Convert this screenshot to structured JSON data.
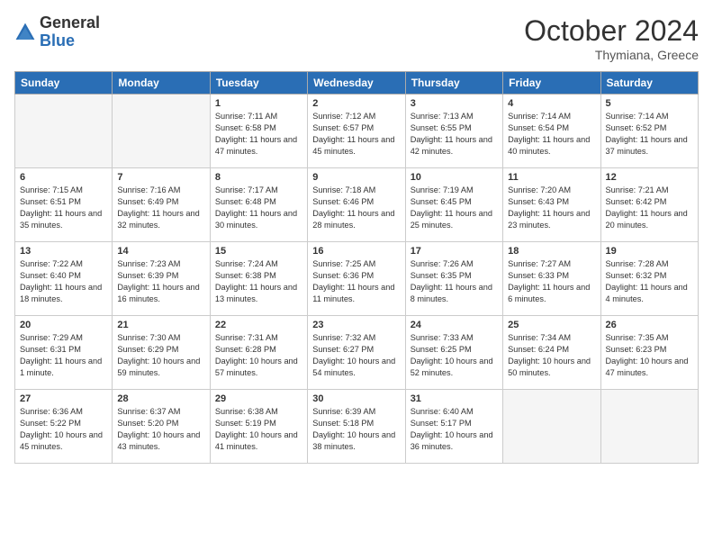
{
  "header": {
    "logo_general": "General",
    "logo_blue": "Blue",
    "month_title": "October 2024",
    "subtitle": "Thymiana, Greece"
  },
  "weekdays": [
    "Sunday",
    "Monday",
    "Tuesday",
    "Wednesday",
    "Thursday",
    "Friday",
    "Saturday"
  ],
  "weeks": [
    [
      {
        "day": "",
        "sunrise": "",
        "sunset": "",
        "daylight": "",
        "empty": true
      },
      {
        "day": "",
        "sunrise": "",
        "sunset": "",
        "daylight": "",
        "empty": true
      },
      {
        "day": "1",
        "sunrise": "Sunrise: 7:11 AM",
        "sunset": "Sunset: 6:58 PM",
        "daylight": "Daylight: 11 hours and 47 minutes.",
        "empty": false
      },
      {
        "day": "2",
        "sunrise": "Sunrise: 7:12 AM",
        "sunset": "Sunset: 6:57 PM",
        "daylight": "Daylight: 11 hours and 45 minutes.",
        "empty": false
      },
      {
        "day": "3",
        "sunrise": "Sunrise: 7:13 AM",
        "sunset": "Sunset: 6:55 PM",
        "daylight": "Daylight: 11 hours and 42 minutes.",
        "empty": false
      },
      {
        "day": "4",
        "sunrise": "Sunrise: 7:14 AM",
        "sunset": "Sunset: 6:54 PM",
        "daylight": "Daylight: 11 hours and 40 minutes.",
        "empty": false
      },
      {
        "day": "5",
        "sunrise": "Sunrise: 7:14 AM",
        "sunset": "Sunset: 6:52 PM",
        "daylight": "Daylight: 11 hours and 37 minutes.",
        "empty": false
      }
    ],
    [
      {
        "day": "6",
        "sunrise": "Sunrise: 7:15 AM",
        "sunset": "Sunset: 6:51 PM",
        "daylight": "Daylight: 11 hours and 35 minutes.",
        "empty": false
      },
      {
        "day": "7",
        "sunrise": "Sunrise: 7:16 AM",
        "sunset": "Sunset: 6:49 PM",
        "daylight": "Daylight: 11 hours and 32 minutes.",
        "empty": false
      },
      {
        "day": "8",
        "sunrise": "Sunrise: 7:17 AM",
        "sunset": "Sunset: 6:48 PM",
        "daylight": "Daylight: 11 hours and 30 minutes.",
        "empty": false
      },
      {
        "day": "9",
        "sunrise": "Sunrise: 7:18 AM",
        "sunset": "Sunset: 6:46 PM",
        "daylight": "Daylight: 11 hours and 28 minutes.",
        "empty": false
      },
      {
        "day": "10",
        "sunrise": "Sunrise: 7:19 AM",
        "sunset": "Sunset: 6:45 PM",
        "daylight": "Daylight: 11 hours and 25 minutes.",
        "empty": false
      },
      {
        "day": "11",
        "sunrise": "Sunrise: 7:20 AM",
        "sunset": "Sunset: 6:43 PM",
        "daylight": "Daylight: 11 hours and 23 minutes.",
        "empty": false
      },
      {
        "day": "12",
        "sunrise": "Sunrise: 7:21 AM",
        "sunset": "Sunset: 6:42 PM",
        "daylight": "Daylight: 11 hours and 20 minutes.",
        "empty": false
      }
    ],
    [
      {
        "day": "13",
        "sunrise": "Sunrise: 7:22 AM",
        "sunset": "Sunset: 6:40 PM",
        "daylight": "Daylight: 11 hours and 18 minutes.",
        "empty": false
      },
      {
        "day": "14",
        "sunrise": "Sunrise: 7:23 AM",
        "sunset": "Sunset: 6:39 PM",
        "daylight": "Daylight: 11 hours and 16 minutes.",
        "empty": false
      },
      {
        "day": "15",
        "sunrise": "Sunrise: 7:24 AM",
        "sunset": "Sunset: 6:38 PM",
        "daylight": "Daylight: 11 hours and 13 minutes.",
        "empty": false
      },
      {
        "day": "16",
        "sunrise": "Sunrise: 7:25 AM",
        "sunset": "Sunset: 6:36 PM",
        "daylight": "Daylight: 11 hours and 11 minutes.",
        "empty": false
      },
      {
        "day": "17",
        "sunrise": "Sunrise: 7:26 AM",
        "sunset": "Sunset: 6:35 PM",
        "daylight": "Daylight: 11 hours and 8 minutes.",
        "empty": false
      },
      {
        "day": "18",
        "sunrise": "Sunrise: 7:27 AM",
        "sunset": "Sunset: 6:33 PM",
        "daylight": "Daylight: 11 hours and 6 minutes.",
        "empty": false
      },
      {
        "day": "19",
        "sunrise": "Sunrise: 7:28 AM",
        "sunset": "Sunset: 6:32 PM",
        "daylight": "Daylight: 11 hours and 4 minutes.",
        "empty": false
      }
    ],
    [
      {
        "day": "20",
        "sunrise": "Sunrise: 7:29 AM",
        "sunset": "Sunset: 6:31 PM",
        "daylight": "Daylight: 11 hours and 1 minute.",
        "empty": false
      },
      {
        "day": "21",
        "sunrise": "Sunrise: 7:30 AM",
        "sunset": "Sunset: 6:29 PM",
        "daylight": "Daylight: 10 hours and 59 minutes.",
        "empty": false
      },
      {
        "day": "22",
        "sunrise": "Sunrise: 7:31 AM",
        "sunset": "Sunset: 6:28 PM",
        "daylight": "Daylight: 10 hours and 57 minutes.",
        "empty": false
      },
      {
        "day": "23",
        "sunrise": "Sunrise: 7:32 AM",
        "sunset": "Sunset: 6:27 PM",
        "daylight": "Daylight: 10 hours and 54 minutes.",
        "empty": false
      },
      {
        "day": "24",
        "sunrise": "Sunrise: 7:33 AM",
        "sunset": "Sunset: 6:25 PM",
        "daylight": "Daylight: 10 hours and 52 minutes.",
        "empty": false
      },
      {
        "day": "25",
        "sunrise": "Sunrise: 7:34 AM",
        "sunset": "Sunset: 6:24 PM",
        "daylight": "Daylight: 10 hours and 50 minutes.",
        "empty": false
      },
      {
        "day": "26",
        "sunrise": "Sunrise: 7:35 AM",
        "sunset": "Sunset: 6:23 PM",
        "daylight": "Daylight: 10 hours and 47 minutes.",
        "empty": false
      }
    ],
    [
      {
        "day": "27",
        "sunrise": "Sunrise: 6:36 AM",
        "sunset": "Sunset: 5:22 PM",
        "daylight": "Daylight: 10 hours and 45 minutes.",
        "empty": false
      },
      {
        "day": "28",
        "sunrise": "Sunrise: 6:37 AM",
        "sunset": "Sunset: 5:20 PM",
        "daylight": "Daylight: 10 hours and 43 minutes.",
        "empty": false
      },
      {
        "day": "29",
        "sunrise": "Sunrise: 6:38 AM",
        "sunset": "Sunset: 5:19 PM",
        "daylight": "Daylight: 10 hours and 41 minutes.",
        "empty": false
      },
      {
        "day": "30",
        "sunrise": "Sunrise: 6:39 AM",
        "sunset": "Sunset: 5:18 PM",
        "daylight": "Daylight: 10 hours and 38 minutes.",
        "empty": false
      },
      {
        "day": "31",
        "sunrise": "Sunrise: 6:40 AM",
        "sunset": "Sunset: 5:17 PM",
        "daylight": "Daylight: 10 hours and 36 minutes.",
        "empty": false
      },
      {
        "day": "",
        "sunrise": "",
        "sunset": "",
        "daylight": "",
        "empty": true
      },
      {
        "day": "",
        "sunrise": "",
        "sunset": "",
        "daylight": "",
        "empty": true
      }
    ]
  ]
}
